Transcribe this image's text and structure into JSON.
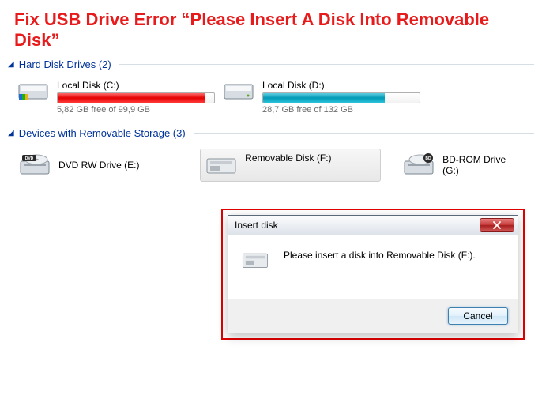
{
  "title": "Fix USB Drive Error “Please Insert A Disk Into Removable Disk”",
  "sections": {
    "hdd": {
      "label": "Hard Disk Drives (2)",
      "drives": [
        {
          "label": "Local Disk (C:)",
          "sub": "5,82 GB free of 99,9 GB",
          "fill": 94,
          "color": "red"
        },
        {
          "label": "Local Disk (D:)",
          "sub": "28,7 GB free of 132 GB",
          "fill": 78,
          "color": "teal"
        }
      ]
    },
    "removable": {
      "label": "Devices with Removable Storage (3)",
      "devices": [
        {
          "label": "DVD RW Drive (E:)",
          "icon": "dvd"
        },
        {
          "label": "Removable Disk (F:)",
          "icon": "removable"
        },
        {
          "label": "BD-ROM Drive (G:)",
          "icon": "bd"
        }
      ]
    }
  },
  "dialog": {
    "title": "Insert disk",
    "message": "Please insert a disk into Removable Disk (F:).",
    "cancel": "Cancel"
  }
}
